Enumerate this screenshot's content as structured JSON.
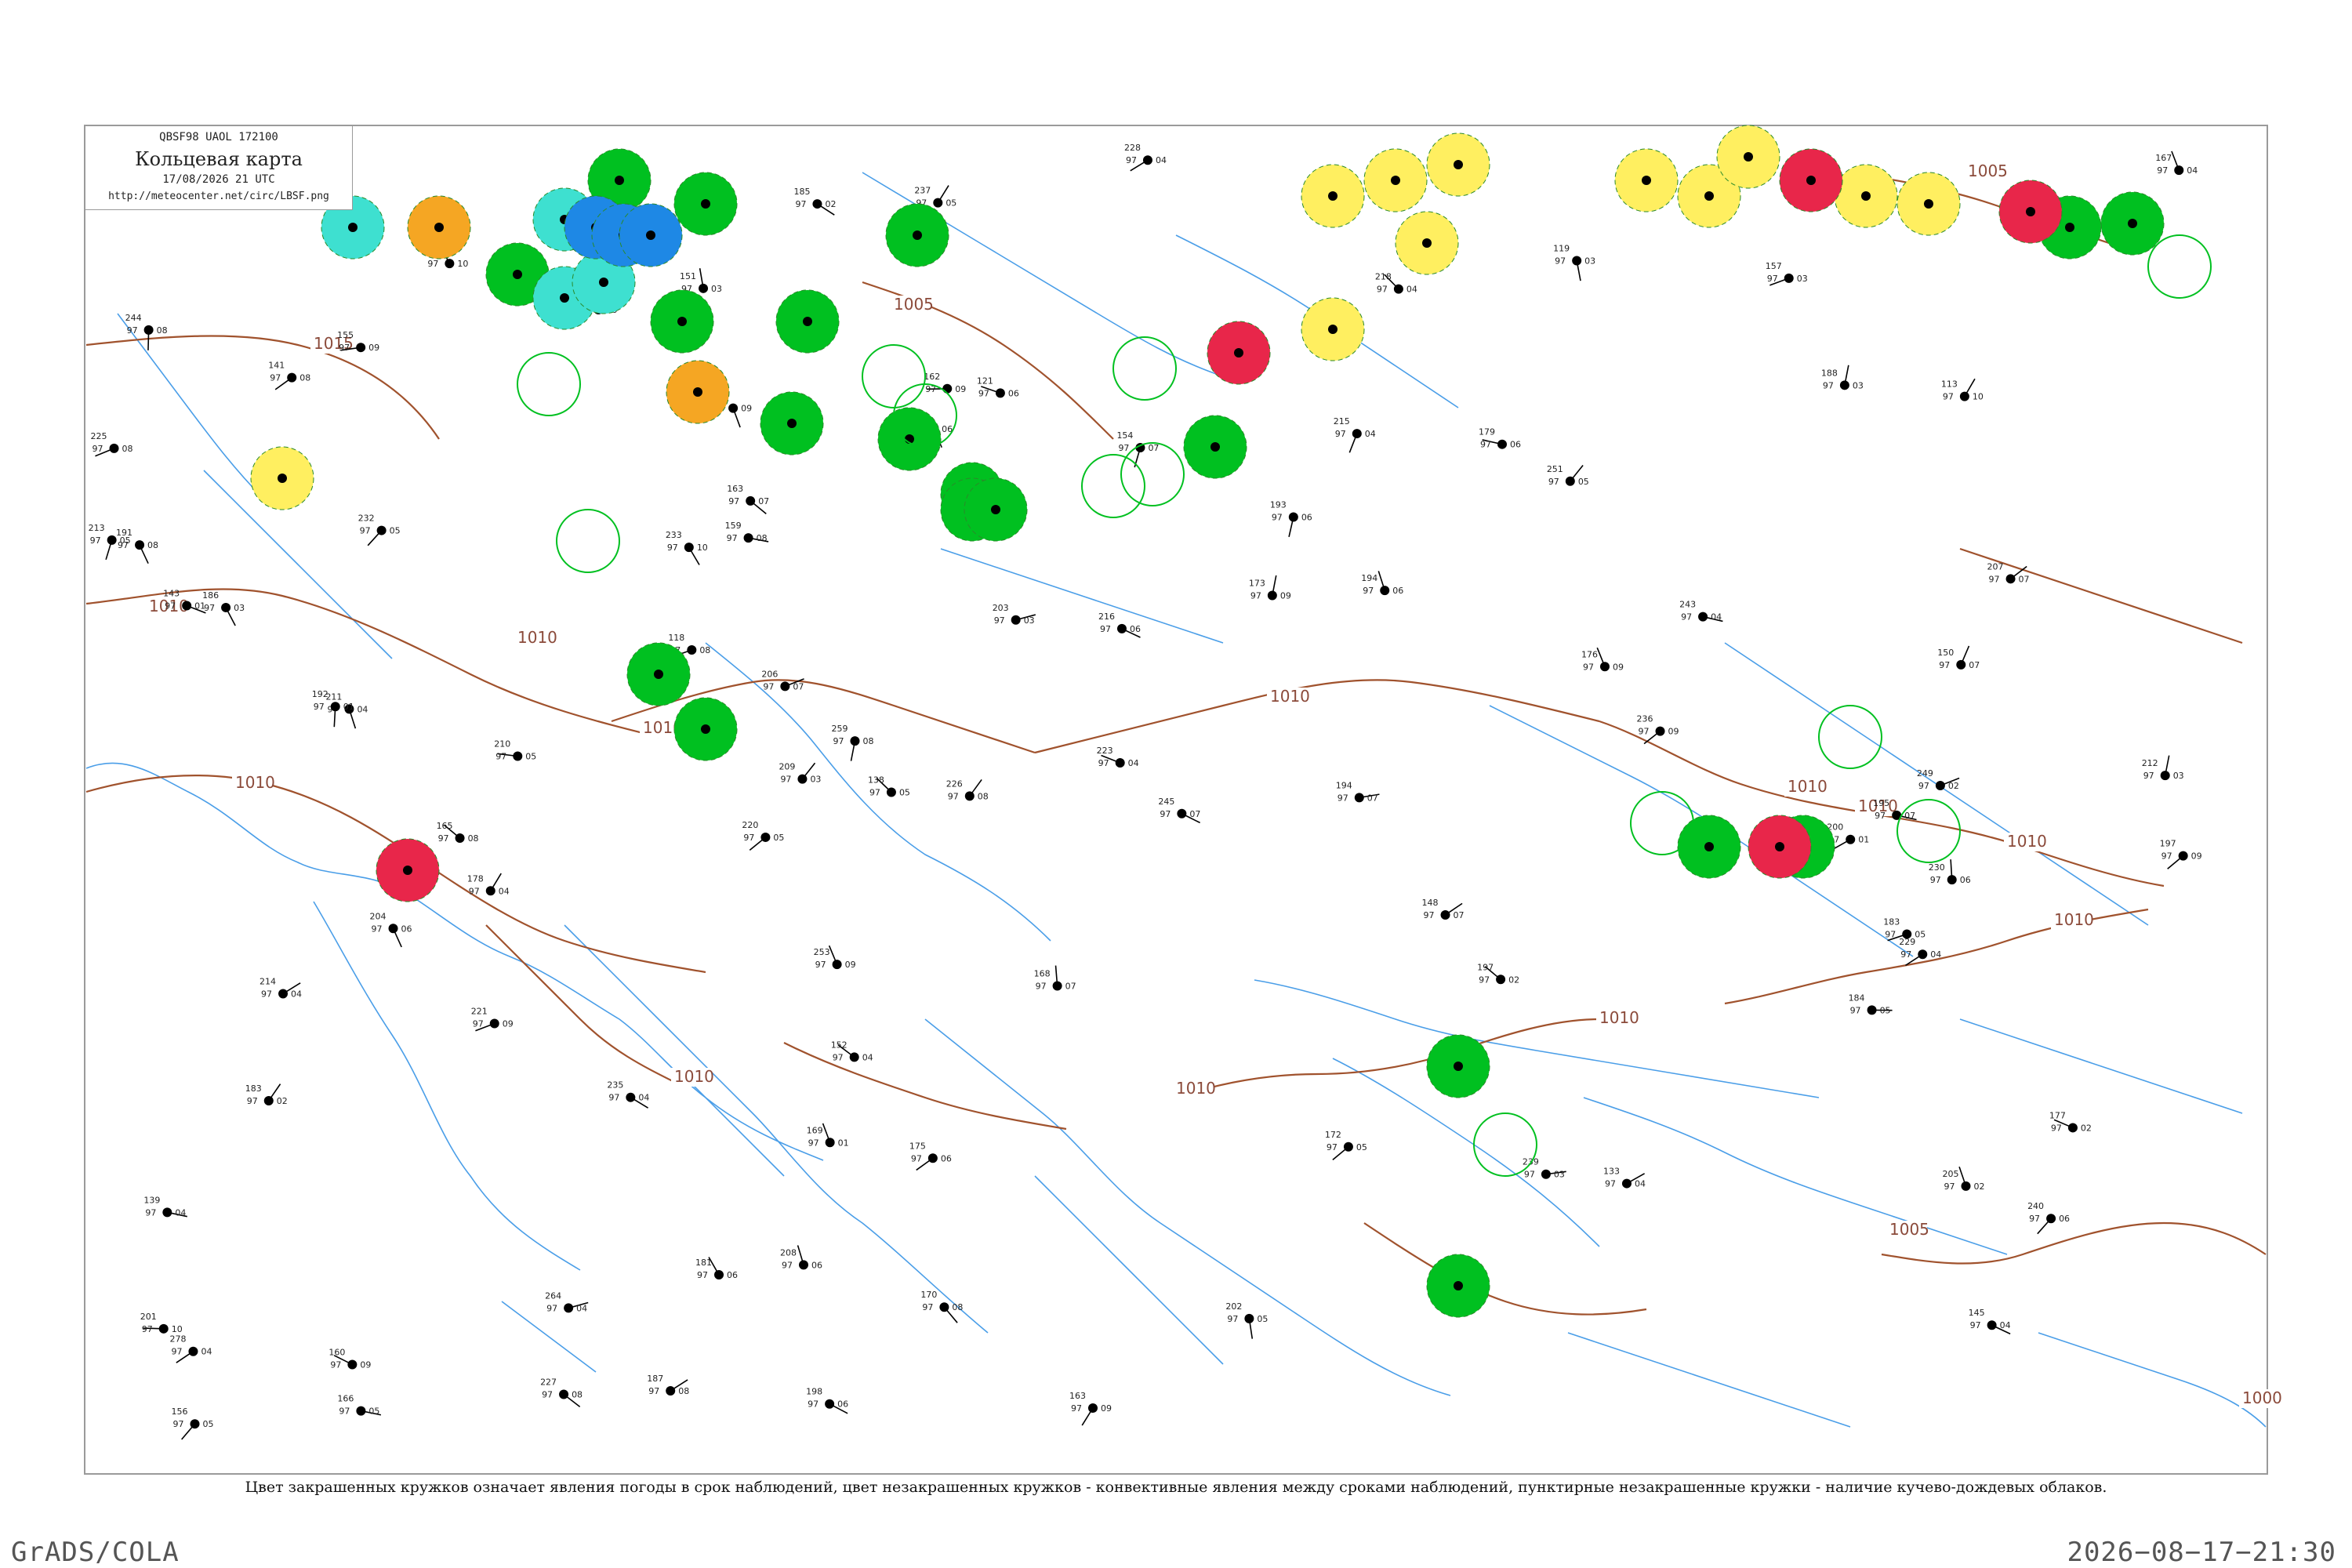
{
  "header": {
    "code": "QBSF98  UAOL  172100",
    "title": "Кольцевая карта",
    "date": "17/08/2026 21 UTC",
    "url": "http://meteocenter.net/circ/LBSF.png"
  },
  "caption": "Цвет закрашенных кружков означает явления погоды в срок наблюдений, цвет незакрашенных кружков - конвективные явления между сроками наблюдений, пунктирные незакрашенные кружки - наличие кучево-дождевых облаков.",
  "footer": {
    "software": "GrADS/COLA",
    "timestamp": "2026−08−17−21:30"
  },
  "colors": {
    "frame": "#9a9a9a",
    "coast": "#4a9ee8",
    "isobar": "#a0522d",
    "green": "#00c020",
    "yellow": "#ffef60",
    "orange": "#f5a623",
    "red": "#e8264a",
    "cyan": "#3ee0d0",
    "blue": "#1e88e5"
  },
  "isobar_labels": [
    "1015",
    "1010",
    "1010",
    "1010",
    "1010",
    "1010",
    "1010",
    "1010",
    "1010",
    "1005",
    "1005",
    "1005",
    "1010",
    "1010",
    "1010",
    "1010",
    "1000"
  ],
  "weather_markers": [
    {
      "color": "green",
      "type": "filled"
    },
    {
      "color": "green",
      "type": "filled"
    },
    {
      "color": "green",
      "type": "filled"
    },
    {
      "color": "green",
      "type": "filled"
    },
    {
      "color": "green",
      "type": "filled"
    },
    {
      "color": "green",
      "type": "filled"
    },
    {
      "color": "green",
      "type": "filled"
    },
    {
      "color": "green",
      "type": "filled"
    },
    {
      "color": "green",
      "type": "filled"
    },
    {
      "color": "green",
      "type": "filled"
    },
    {
      "color": "green",
      "type": "filled"
    },
    {
      "color": "green",
      "type": "filled"
    },
    {
      "color": "green",
      "type": "filled"
    },
    {
      "color": "green",
      "type": "filled"
    },
    {
      "color": "green",
      "type": "filled"
    },
    {
      "color": "green",
      "type": "filled"
    },
    {
      "color": "green",
      "type": "filled"
    },
    {
      "color": "green",
      "type": "filled"
    },
    {
      "color": "green",
      "type": "filled"
    },
    {
      "color": "green",
      "type": "filled"
    },
    {
      "color": "yellow",
      "type": "filled"
    },
    {
      "color": "yellow",
      "type": "filled"
    },
    {
      "color": "yellow",
      "type": "filled"
    },
    {
      "color": "yellow",
      "type": "filled"
    },
    {
      "color": "yellow",
      "type": "filled"
    },
    {
      "color": "yellow",
      "type": "filled"
    },
    {
      "color": "yellow",
      "type": "filled"
    },
    {
      "color": "yellow",
      "type": "filled"
    },
    {
      "color": "yellow",
      "type": "filled"
    },
    {
      "color": "yellow",
      "type": "filled"
    },
    {
      "color": "yellow",
      "type": "filled"
    },
    {
      "color": "orange",
      "type": "filled"
    },
    {
      "color": "orange",
      "type": "filled"
    },
    {
      "color": "red",
      "type": "filled"
    },
    {
      "color": "red",
      "type": "filled"
    },
    {
      "color": "red",
      "type": "filled"
    },
    {
      "color": "red",
      "type": "filled"
    },
    {
      "color": "red",
      "type": "filled"
    },
    {
      "color": "cyan",
      "type": "filled"
    },
    {
      "color": "cyan",
      "type": "filled"
    },
    {
      "color": "cyan",
      "type": "filled"
    },
    {
      "color": "cyan",
      "type": "filled"
    },
    {
      "color": "blue",
      "type": "filled"
    },
    {
      "color": "blue",
      "type": "filled"
    },
    {
      "color": "blue",
      "type": "filled"
    },
    {
      "color": "green",
      "type": "outline"
    },
    {
      "color": "green",
      "type": "outline"
    },
    {
      "color": "green",
      "type": "outline"
    },
    {
      "color": "green",
      "type": "outline"
    },
    {
      "color": "green",
      "type": "outline"
    },
    {
      "color": "green",
      "type": "outline"
    },
    {
      "color": "green",
      "type": "outline"
    },
    {
      "color": "green",
      "type": "outline"
    },
    {
      "color": "green",
      "type": "outline"
    },
    {
      "color": "green",
      "type": "outline"
    },
    {
      "color": "green",
      "type": "outline"
    },
    {
      "color": "green",
      "type": "outline"
    },
    {
      "color": "red",
      "type": "outline"
    }
  ],
  "station_readings": [
    [
      "145",
      "97",
      "04"
    ],
    [
      "170",
      "97",
      "08"
    ],
    [
      "138",
      "97",
      "05"
    ],
    [
      "131",
      "97",
      "06"
    ],
    [
      "162",
      "97",
      "09"
    ],
    [
      "151",
      "97",
      "03"
    ],
    [
      "159",
      "97",
      "08"
    ],
    [
      "113",
      "97",
      "10"
    ],
    [
      "121",
      "97",
      "06"
    ],
    [
      "152",
      "97",
      "04"
    ],
    [
      "141",
      "97",
      "08"
    ],
    [
      "156",
      "97",
      "05"
    ],
    [
      "148",
      "97",
      "07"
    ],
    [
      "118",
      "97",
      "08"
    ],
    [
      "175",
      "97",
      "06"
    ],
    [
      "142",
      "97",
      "06"
    ],
    [
      "119",
      "97",
      "03"
    ],
    [
      "133",
      "97",
      "04"
    ],
    [
      "205",
      "97",
      "02"
    ],
    [
      "194",
      "97",
      "07"
    ],
    [
      "233",
      "97",
      "10"
    ],
    [
      "253",
      "97",
      "09"
    ],
    [
      "264",
      "97",
      "04"
    ],
    [
      "220",
      "97",
      "05"
    ],
    [
      "278",
      "97",
      "04"
    ],
    [
      "200",
      "97",
      "01"
    ],
    [
      "183",
      "97",
      "02"
    ],
    [
      "227",
      "97",
      "08"
    ],
    [
      "197",
      "97",
      "02"
    ],
    [
      "188",
      "97",
      "03"
    ],
    [
      "166",
      "97",
      "05"
    ],
    [
      "212",
      "97",
      "03"
    ],
    [
      "157",
      "97",
      "03"
    ],
    [
      "225",
      "97",
      "08"
    ],
    [
      "191",
      "97",
      "08"
    ],
    [
      "235",
      "97",
      "04"
    ],
    [
      "160",
      "97",
      "09"
    ],
    [
      "143",
      "97",
      "01"
    ],
    [
      "203",
      "97",
      "03"
    ],
    [
      "176",
      "97",
      "09"
    ],
    [
      "181",
      "97",
      "06"
    ],
    [
      "215",
      "97",
      "04"
    ],
    [
      "139",
      "97",
      "04"
    ],
    [
      "244",
      "97",
      "08"
    ],
    [
      "197",
      "97",
      "09"
    ],
    [
      "209",
      "97",
      "03"
    ],
    [
      "216",
      "97",
      "06"
    ],
    [
      "183",
      "97",
      "05"
    ],
    [
      "229",
      "97",
      "04"
    ],
    [
      "240",
      "97",
      "06"
    ],
    [
      "168",
      "97",
      "07"
    ],
    [
      "249",
      "97",
      "02"
    ],
    [
      "172",
      "97",
      "05"
    ],
    [
      "201",
      "97",
      "10"
    ],
    [
      "194",
      "97",
      "06"
    ],
    [
      "236",
      "97",
      "09"
    ],
    [
      "184",
      "97",
      "05"
    ],
    [
      "206",
      "97",
      "07"
    ],
    [
      "218",
      "97",
      "04"
    ],
    [
      "155",
      "97",
      "09"
    ],
    [
      "187",
      "97",
      "08"
    ],
    [
      "163",
      "97",
      "09"
    ],
    [
      "204",
      "97",
      "06"
    ],
    [
      "251",
      "97",
      "05"
    ],
    [
      "173",
      "97",
      "09"
    ],
    [
      "232",
      "97",
      "05"
    ],
    [
      "195",
      "97",
      "07"
    ],
    [
      "211",
      "97",
      "04"
    ],
    [
      "259",
      "97",
      "08"
    ],
    [
      "167",
      "97",
      "04"
    ],
    [
      "226",
      "97",
      "08"
    ],
    [
      "186",
      "97",
      "03"
    ],
    [
      "198",
      "97",
      "06"
    ],
    [
      "239",
      "97",
      "03"
    ],
    [
      "154",
      "97",
      "07"
    ],
    [
      "221",
      "97",
      "09"
    ],
    [
      "178",
      "97",
      "04"
    ],
    [
      "207",
      "97",
      "07"
    ],
    [
      "243",
      "97",
      "04"
    ],
    [
      "189",
      "97",
      "10"
    ],
    [
      "202",
      "97",
      "05"
    ],
    [
      "163",
      "97",
      "07"
    ],
    [
      "230",
      "97",
      "06"
    ],
    [
      "179",
      "97",
      "06"
    ],
    [
      "214",
      "97",
      "04"
    ],
    [
      "193",
      "97",
      "06"
    ],
    [
      "245",
      "97",
      "07"
    ],
    [
      "169",
      "97",
      "01"
    ],
    [
      "223",
      "97",
      "04"
    ],
    [
      "185",
      "97",
      "02"
    ],
    [
      "208",
      "97",
      "06"
    ],
    [
      "150",
      "97",
      "07"
    ],
    [
      "237",
      "97",
      "05"
    ],
    [
      "196",
      "97",
      "09"
    ],
    [
      "213",
      "97",
      "05"
    ],
    [
      "177",
      "97",
      "02"
    ],
    [
      "228",
      "97",
      "04"
    ],
    [
      "192",
      "97",
      "01"
    ],
    [
      "210",
      "97",
      "05"
    ],
    [
      "165",
      "97",
      "08"
    ]
  ]
}
